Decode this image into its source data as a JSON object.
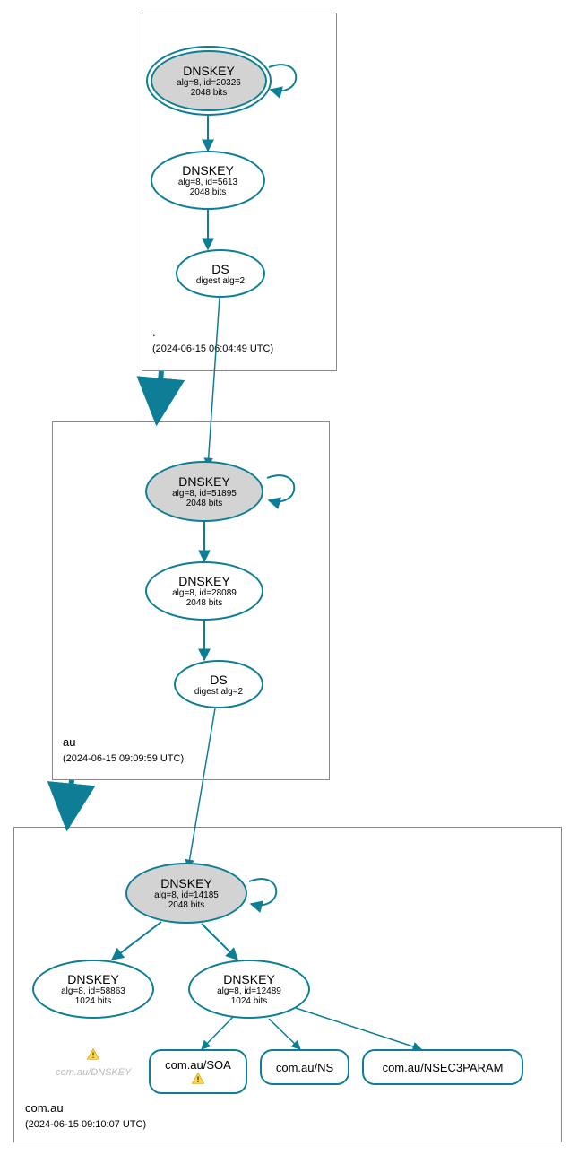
{
  "zones": {
    "root": {
      "name": ".",
      "timestamp": "(2024-06-15 06:04:49 UTC)"
    },
    "au": {
      "name": "au",
      "timestamp": "(2024-06-15 09:09:59 UTC)"
    },
    "comau": {
      "name": "com.au",
      "timestamp": "(2024-06-15 09:10:07 UTC)"
    }
  },
  "nodes": {
    "root_ksk": {
      "title": "DNSKEY",
      "l1": "alg=8, id=20326",
      "l2": "2048 bits"
    },
    "root_zsk": {
      "title": "DNSKEY",
      "l1": "alg=8, id=5613",
      "l2": "2048 bits"
    },
    "root_ds": {
      "title": "DS",
      "l1": "digest alg=2"
    },
    "au_ksk": {
      "title": "DNSKEY",
      "l1": "alg=8, id=51895",
      "l2": "2048 bits"
    },
    "au_zsk": {
      "title": "DNSKEY",
      "l1": "alg=8, id=28089",
      "l2": "2048 bits"
    },
    "au_ds": {
      "title": "DS",
      "l1": "digest alg=2"
    },
    "comau_ksk": {
      "title": "DNSKEY",
      "l1": "alg=8, id=14185",
      "l2": "2048 bits"
    },
    "comau_zsk1": {
      "title": "DNSKEY",
      "l1": "alg=8, id=58863",
      "l2": "1024 bits"
    },
    "comau_zsk2": {
      "title": "DNSKEY",
      "l1": "alg=8, id=12489",
      "l2": "1024 bits"
    },
    "soa": {
      "label": "com.au/SOA"
    },
    "ns": {
      "label": "com.au/NS"
    },
    "nsec3": {
      "label": "com.au/NSEC3PARAM"
    },
    "ghost": {
      "label": "com.au/DNSKEY"
    }
  },
  "chart_data": {
    "type": "graph",
    "description": "DNSSEC authentication chain / DNSViz-style delegation graph",
    "zones": [
      {
        "name": ".",
        "timestamp": "2024-06-15 06:04:49 UTC"
      },
      {
        "name": "au",
        "timestamp": "2024-06-15 09:09:59 UTC"
      },
      {
        "name": "com.au",
        "timestamp": "2024-06-15 09:10:07 UTC"
      }
    ],
    "nodes": [
      {
        "id": "root_ksk",
        "zone": ".",
        "type": "DNSKEY",
        "alg": 8,
        "key_id": 20326,
        "bits": 2048,
        "role": "KSK",
        "trust_anchor": true
      },
      {
        "id": "root_zsk",
        "zone": ".",
        "type": "DNSKEY",
        "alg": 8,
        "key_id": 5613,
        "bits": 2048,
        "role": "ZSK"
      },
      {
        "id": "root_ds",
        "zone": ".",
        "type": "DS",
        "digest_alg": 2
      },
      {
        "id": "au_ksk",
        "zone": "au",
        "type": "DNSKEY",
        "alg": 8,
        "key_id": 51895,
        "bits": 2048,
        "role": "KSK"
      },
      {
        "id": "au_zsk",
        "zone": "au",
        "type": "DNSKEY",
        "alg": 8,
        "key_id": 28089,
        "bits": 2048,
        "role": "ZSK"
      },
      {
        "id": "au_ds",
        "zone": "au",
        "type": "DS",
        "digest_alg": 2
      },
      {
        "id": "comau_ksk",
        "zone": "com.au",
        "type": "DNSKEY",
        "alg": 8,
        "key_id": 14185,
        "bits": 2048,
        "role": "KSK"
      },
      {
        "id": "comau_zsk1",
        "zone": "com.au",
        "type": "DNSKEY",
        "alg": 8,
        "key_id": 58863,
        "bits": 1024,
        "role": "ZSK"
      },
      {
        "id": "comau_zsk2",
        "zone": "com.au",
        "type": "DNSKEY",
        "alg": 8,
        "key_id": 12489,
        "bits": 1024,
        "role": "ZSK"
      },
      {
        "id": "soa",
        "zone": "com.au",
        "type": "RRset",
        "name": "com.au/SOA",
        "warning": true
      },
      {
        "id": "ns",
        "zone": "com.au",
        "type": "RRset",
        "name": "com.au/NS"
      },
      {
        "id": "nsec3",
        "zone": "com.au",
        "type": "RRset",
        "name": "com.au/NSEC3PARAM"
      },
      {
        "id": "ghost",
        "zone": "com.au",
        "type": "RRset",
        "name": "com.au/DNSKEY",
        "warning": true,
        "faded": true
      }
    ],
    "edges": [
      {
        "from": "root_ksk",
        "to": "root_ksk",
        "kind": "self-sign"
      },
      {
        "from": "root_ksk",
        "to": "root_zsk",
        "kind": "signs"
      },
      {
        "from": "root_zsk",
        "to": "root_ds",
        "kind": "signs"
      },
      {
        "from": "root_ds",
        "to": "au_ksk",
        "kind": "delegation"
      },
      {
        "from": "au_ksk",
        "to": "au_ksk",
        "kind": "self-sign"
      },
      {
        "from": "au_ksk",
        "to": "au_zsk",
        "kind": "signs"
      },
      {
        "from": "au_zsk",
        "to": "au_ds",
        "kind": "signs"
      },
      {
        "from": "au_ds",
        "to": "comau_ksk",
        "kind": "delegation"
      },
      {
        "from": "comau_ksk",
        "to": "comau_ksk",
        "kind": "self-sign"
      },
      {
        "from": "comau_ksk",
        "to": "comau_zsk1",
        "kind": "signs"
      },
      {
        "from": "comau_ksk",
        "to": "comau_zsk2",
        "kind": "signs"
      },
      {
        "from": "comau_zsk2",
        "to": "soa",
        "kind": "signs"
      },
      {
        "from": "comau_zsk2",
        "to": "ns",
        "kind": "signs"
      },
      {
        "from": "comau_zsk2",
        "to": "nsec3",
        "kind": "signs"
      }
    ]
  }
}
